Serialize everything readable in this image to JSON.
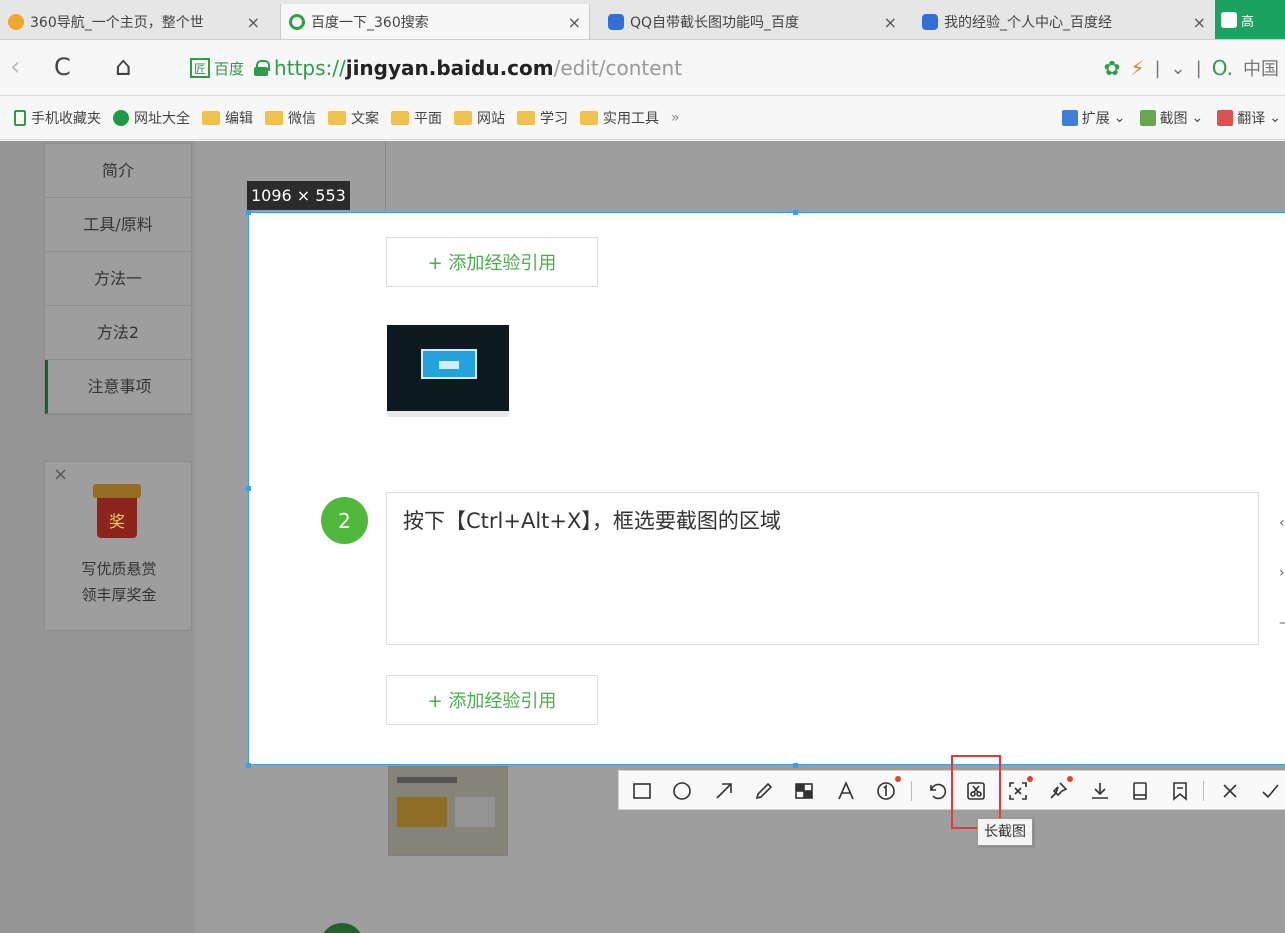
{
  "tabs": [
    {
      "title": "360导航_一个主页，整个世",
      "icon": "360-icon"
    },
    {
      "title": "百度一下_360搜索",
      "icon": "360-search-icon"
    },
    {
      "title": "QQ自带截长图功能吗_百度",
      "icon": "baidu-paw-icon"
    },
    {
      "title": "我的经验_个人中心_百度经",
      "icon": "baidu-paw-icon"
    },
    {
      "title": "高",
      "icon": "baidu-paw-icon"
    }
  ],
  "tab_close_glyph": "×",
  "nav": {
    "back": "‹",
    "reload": "C",
    "home": "⌂",
    "site_badge": "百度",
    "url_scheme": "https://",
    "url_host": "jingyan.baidu.com",
    "url_path": "/edit/content",
    "search_text": "中国"
  },
  "bookmarks": [
    {
      "label": "手机收藏夹",
      "icon": "phone-icon"
    },
    {
      "label": "网址大全",
      "icon": "globe-icon"
    },
    {
      "label": "编辑",
      "icon": "folder-icon"
    },
    {
      "label": "微信",
      "icon": "folder-icon"
    },
    {
      "label": "文案",
      "icon": "folder-icon"
    },
    {
      "label": "平面",
      "icon": "folder-icon"
    },
    {
      "label": "网站",
      "icon": "folder-icon"
    },
    {
      "label": "学习",
      "icon": "folder-icon"
    },
    {
      "label": "实用工具",
      "icon": "folder-icon"
    }
  ],
  "bookmarks_more": "»",
  "bookmark_tools": [
    {
      "label": "扩展",
      "color": "#3d7fd9"
    },
    {
      "label": "截图",
      "color": "#6aa84f"
    },
    {
      "label": "翻译",
      "color": "#d9534f"
    }
  ],
  "toc": [
    "简介",
    "工具/原料",
    "方法一",
    "方法2",
    "注意事项"
  ],
  "ad": {
    "close": "×",
    "badge": "奖",
    "line1": "写优质悬赏",
    "line2": "领丰厚奖金"
  },
  "capture": {
    "size_label": "1096 × 553",
    "add_ref_label": "+ 添加经验引用",
    "step_number": "2",
    "step_text": "按下【Ctrl+Alt+X】，框选要截图的区域"
  },
  "toolbar": {
    "tooltip": "长截图",
    "tools": [
      "rectangle",
      "ellipse",
      "arrow",
      "pencil",
      "mosaic",
      "text",
      "number",
      "undo",
      "long-screenshot",
      "ocr",
      "pin",
      "download",
      "save",
      "bookmark",
      "cancel",
      "confirm"
    ]
  },
  "colors": {
    "accent_green": "#4fb83d",
    "selection_border": "#3aa0e8",
    "highlight_red": "#e53935"
  }
}
